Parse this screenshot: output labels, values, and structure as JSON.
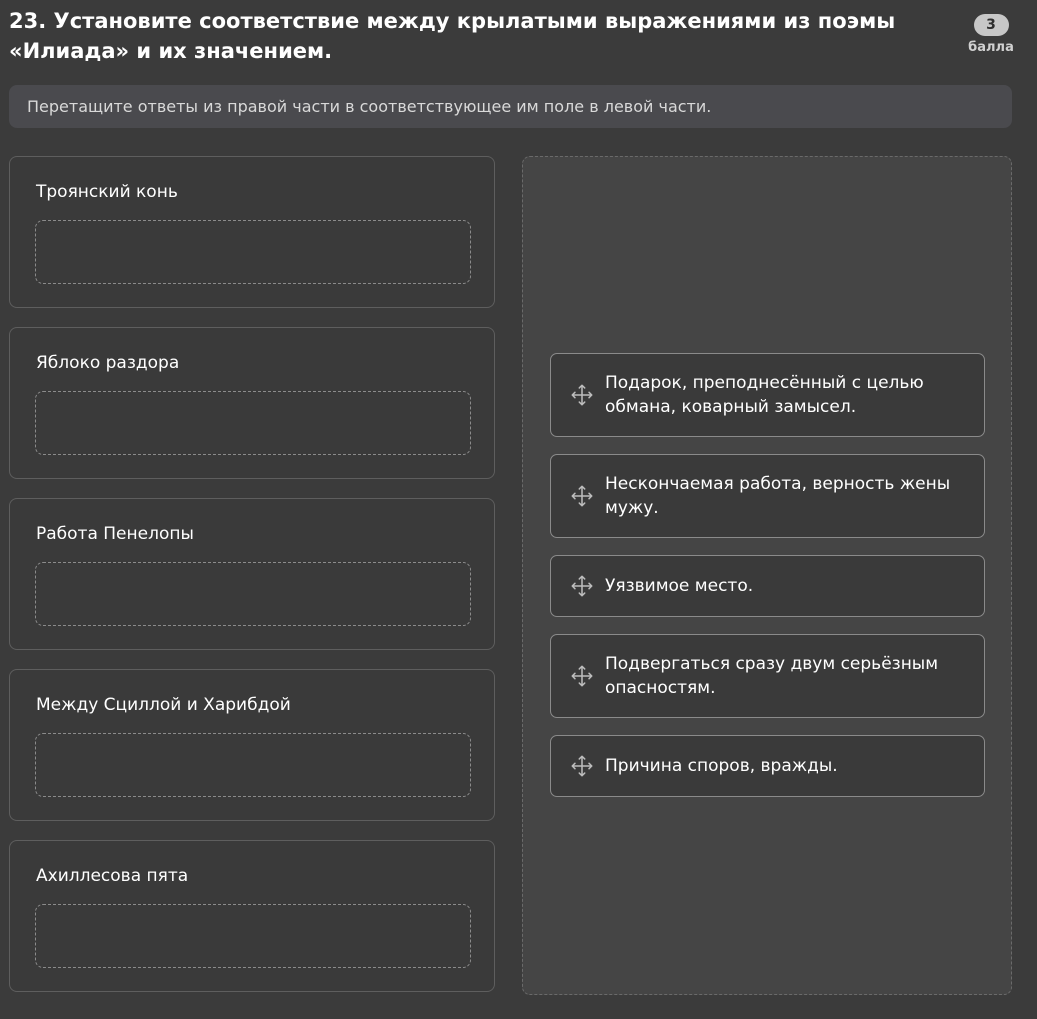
{
  "question": {
    "title": "23. Установите соответствие между крылатыми выражениями из поэмы «Илиада» и их значением.",
    "score_value": "3",
    "score_unit": "балла"
  },
  "instruction": "Перетащите ответы из правой части в соответствующее им поле в левой части.",
  "terms": [
    {
      "label": "Троянский конь"
    },
    {
      "label": "Яблоко раздора"
    },
    {
      "label": "Работа Пенелопы"
    },
    {
      "label": "Между Сциллой и Харибдой"
    },
    {
      "label": "Ахиллесова пята"
    }
  ],
  "answers": [
    {
      "text": "Подарок, преподнесённый с целью обмана, коварный замысел.",
      "icon": "drag-move-icon"
    },
    {
      "text": "Нескончаемая работа, верность жены мужу.",
      "icon": "drag-move-icon"
    },
    {
      "text": "Уязвимое место.",
      "icon": "drag-move-icon"
    },
    {
      "text": "Подвергаться сразу двум серьёзным опасностям.",
      "icon": "drag-move-icon"
    },
    {
      "text": "Причина споров, вражды.",
      "icon": "drag-move-icon"
    }
  ]
}
